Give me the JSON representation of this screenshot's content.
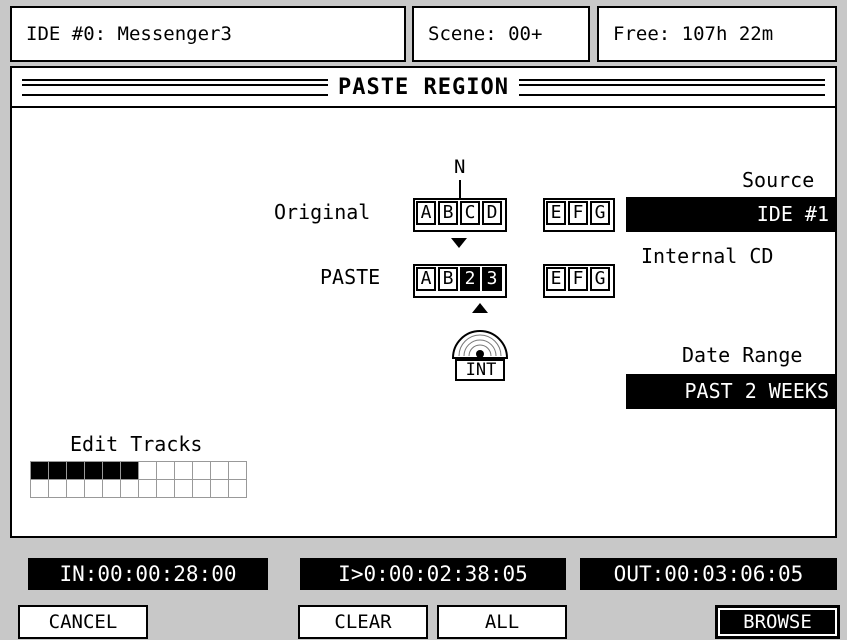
{
  "header": {
    "ide": "IDE #0: Messenger3",
    "scene": "Scene: 00+",
    "free": "Free: 107h 22m"
  },
  "title": "PASTE REGION",
  "diagram": {
    "n_label": "N",
    "original_label": "Original",
    "paste_label": "PASTE",
    "original_cells": [
      "A",
      "B",
      "C",
      "D"
    ],
    "original_tail": [
      "E",
      "F",
      "G"
    ],
    "paste_cells": [
      "A",
      "B",
      "2",
      "3"
    ],
    "paste_tail": [
      "E",
      "F",
      "G"
    ],
    "int_label": "INT"
  },
  "source": {
    "label": "Source",
    "value": "IDE #1",
    "sub": "Internal CD"
  },
  "date_range": {
    "label": "Date Range",
    "value": "PAST 2 WEEKS"
  },
  "edit_tracks": {
    "label": "Edit Tracks",
    "active_count": 6,
    "total": 24
  },
  "timecodes": {
    "in": "IN:00:00:28:00",
    "length": "I>0:00:02:38:05",
    "out": "OUT:00:03:06:05"
  },
  "buttons": {
    "cancel": "CANCEL",
    "clear": "CLEAR",
    "all": "ALL",
    "browse": "BROWSE"
  }
}
